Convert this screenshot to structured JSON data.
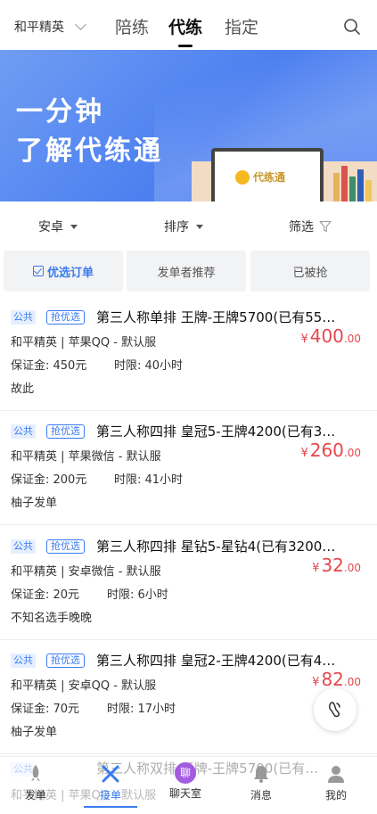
{
  "topnav": {
    "game": "和平精英",
    "tabs": [
      "陪练",
      "代练",
      "指定"
    ],
    "active_tab": "代练"
  },
  "banner": {
    "line1": "一分钟",
    "line2_a": "了解",
    "line2_b": "代练通",
    "monitor_logo": "代练通"
  },
  "filters": {
    "platform": "安卓",
    "sort": "排序",
    "filter": "筛选"
  },
  "segments": [
    "优选订单",
    "发单者推荐",
    "已被抢"
  ],
  "orders": [
    {
      "tag_public": "公共",
      "tag_grab": "抢优选",
      "title": "第三人称单排 王牌-王牌5700(已有55…",
      "game_line": "和平精英 | 苹果QQ - 默认服",
      "currency": "¥",
      "price_int": "400",
      "price_dec": ".00",
      "deposit": "保证金: 450元",
      "time_limit": "时限: 40小时",
      "note": "故此"
    },
    {
      "tag_public": "公共",
      "tag_grab": "抢优选",
      "title": "第三人称四排 皇冠5-王牌4200(已有3…",
      "game_line": "和平精英 | 苹果微信 - 默认服",
      "currency": "¥",
      "price_int": "260",
      "price_dec": ".00",
      "deposit": "保证金: 200元",
      "time_limit": "时限: 41小时",
      "note": "柚子发单"
    },
    {
      "tag_public": "公共",
      "tag_grab": "抢优选",
      "title": "第三人称四排 星钻5-星钻4(已有3200…",
      "game_line": "和平精英 | 安卓微信 - 默认服",
      "currency": "¥",
      "price_int": "32",
      "price_dec": ".00",
      "deposit": "保证金: 20元",
      "time_limit": "时限: 6小时",
      "note": "不知名选手晚晚"
    },
    {
      "tag_public": "公共",
      "tag_grab": "抢优选",
      "title": "第三人称四排 皇冠2-王牌4200(已有4…",
      "game_line": "和平精英 | 安卓QQ - 默认服",
      "currency": "¥",
      "price_int": "82",
      "price_dec": ".00",
      "deposit": "保证金: 70元",
      "time_limit": "时限: 17小时",
      "note": "柚子发单"
    }
  ],
  "partial_order": {
    "tag_public": "公共",
    "title": "第三人称双排 王牌-王牌5700(已有…",
    "game_line": "和平精英 | 苹果QQ - 默认服"
  },
  "bottombar": {
    "items": [
      "发单",
      "接单",
      "聊天室",
      "消息",
      "我的"
    ],
    "active": "接单",
    "chat_badge": "聊"
  },
  "colors": {
    "accent": "#3a7bf0",
    "price": "#e5484d",
    "banner": "#4c7ff0"
  }
}
